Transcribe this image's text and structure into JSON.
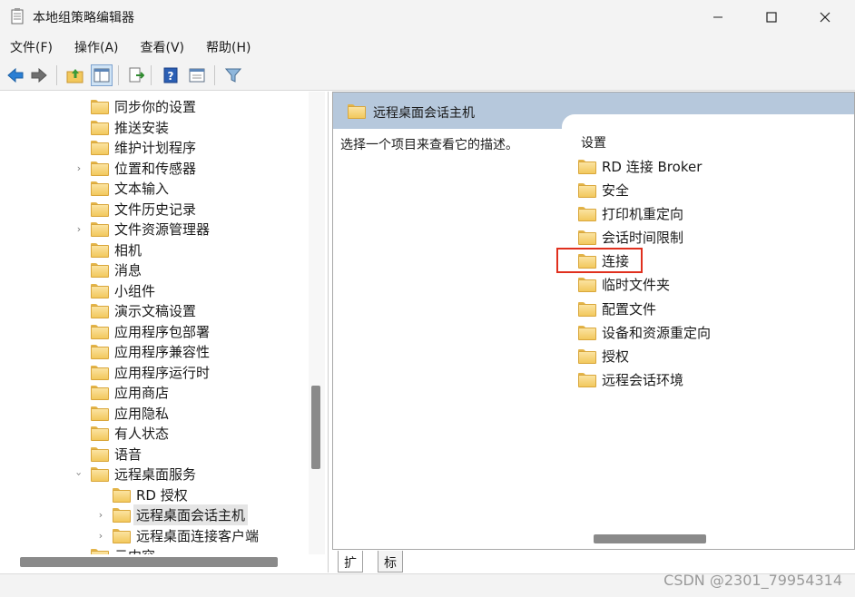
{
  "window": {
    "title": "本地组策略编辑器",
    "minimize": "—",
    "maximize": "☐",
    "close": "✕"
  },
  "menu": [
    "文件(F)",
    "操作(A)",
    "查看(V)",
    "帮助(H)"
  ],
  "toolbar": {
    "icons": [
      "back-icon",
      "forward-icon",
      "up-folder-icon",
      "show-tree-icon",
      "export-list-icon",
      "help-icon",
      "properties-icon",
      "filter-icon"
    ],
    "accent": "#2b7fd4"
  },
  "tree": {
    "items": [
      {
        "label": "同步你的设置",
        "expandable": false,
        "level": 1
      },
      {
        "label": "推送安装",
        "expandable": false,
        "level": 1
      },
      {
        "label": "维护计划程序",
        "expandable": false,
        "level": 1
      },
      {
        "label": "位置和传感器",
        "expandable": true,
        "level": 1
      },
      {
        "label": "文本输入",
        "expandable": false,
        "level": 1
      },
      {
        "label": "文件历史记录",
        "expandable": false,
        "level": 1
      },
      {
        "label": "文件资源管理器",
        "expandable": true,
        "level": 1
      },
      {
        "label": "相机",
        "expandable": false,
        "level": 1
      },
      {
        "label": "消息",
        "expandable": false,
        "level": 1
      },
      {
        "label": "小组件",
        "expandable": false,
        "level": 1
      },
      {
        "label": "演示文稿设置",
        "expandable": false,
        "level": 1
      },
      {
        "label": "应用程序包部署",
        "expandable": false,
        "level": 1
      },
      {
        "label": "应用程序兼容性",
        "expandable": false,
        "level": 1
      },
      {
        "label": "应用程序运行时",
        "expandable": false,
        "level": 1
      },
      {
        "label": "应用商店",
        "expandable": false,
        "level": 1
      },
      {
        "label": "应用隐私",
        "expandable": false,
        "level": 1
      },
      {
        "label": "有人状态",
        "expandable": false,
        "level": 1
      },
      {
        "label": "语音",
        "expandable": false,
        "level": 1
      },
      {
        "label": "远程桌面服务",
        "expandable": true,
        "expanded": true,
        "level": 1
      },
      {
        "label": "RD 授权",
        "expandable": false,
        "level": 2
      },
      {
        "label": "远程桌面会话主机",
        "expandable": true,
        "level": 2,
        "selected": true
      },
      {
        "label": "远程桌面连接客户端",
        "expandable": true,
        "level": 2
      },
      {
        "label": "云内容",
        "expandable": false,
        "level": 1
      }
    ]
  },
  "right": {
    "header_title": "远程桌面会话主机",
    "description": "选择一个项目来查看它的描述。",
    "list_header": "设置",
    "items": [
      "RD 连接 Broker",
      "安全",
      "打印机重定向",
      "会话时间限制",
      "连接",
      "临时文件夹",
      "配置文件",
      "设备和资源重定向",
      "授权",
      "远程会话环境"
    ],
    "highlighted_item": "连接",
    "highlight_color": "#e0301e"
  },
  "tabs": [
    "扩展",
    "标准"
  ],
  "watermark": "CSDN @2301_79954314"
}
